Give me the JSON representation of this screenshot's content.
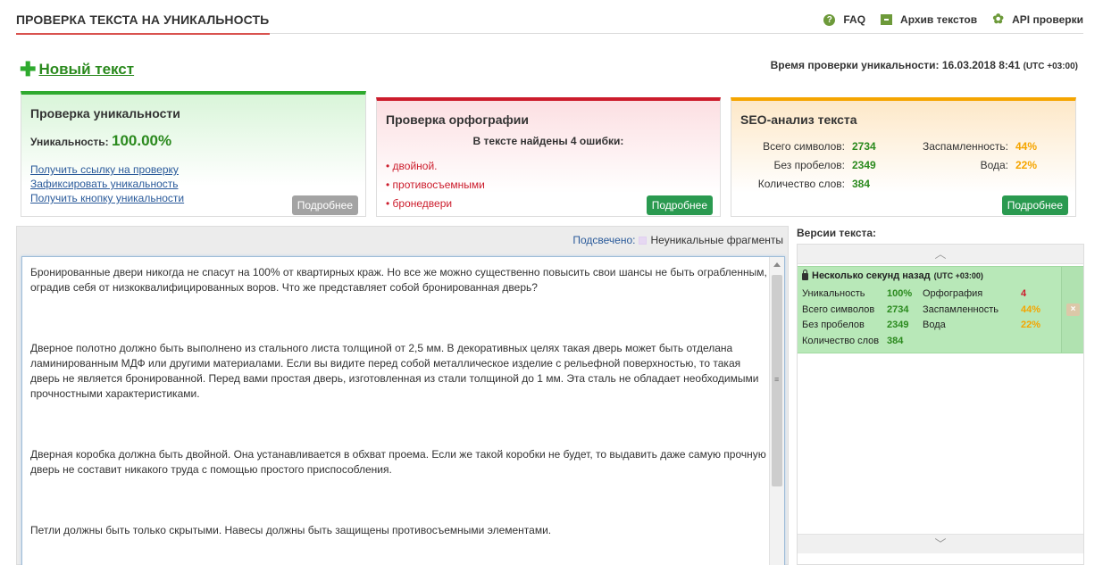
{
  "header": {
    "title": "ПРОВЕРКА ТЕКСТА НА УНИКАЛЬНОСТЬ",
    "nav": [
      {
        "label": "FAQ",
        "icon": "question-icon"
      },
      {
        "label": "Архив текстов",
        "icon": "archive-icon"
      },
      {
        "label": "API проверки",
        "icon": "gear-icon"
      }
    ]
  },
  "new_text": {
    "label": "Новый текст",
    "icon": "plus-icon"
  },
  "check_time": {
    "label": "Время проверки уникальности: 16.03.2018 8:41",
    "tz": "(UTC +03:00)"
  },
  "uniqueness": {
    "title": "Проверка уникальности",
    "label": "Уникальность:",
    "value": "100.00%",
    "links": [
      "Получить ссылку на проверку",
      "Зафиксировать уникальность",
      "Получить кнопку уникальности"
    ],
    "more": "Подробнее"
  },
  "spelling": {
    "title": "Проверка орфографии",
    "count_text": "В тексте найдены 4 ошибки:",
    "errors": [
      "двойной.",
      "противосъемными",
      "бронедвери"
    ],
    "more": "Подробнее"
  },
  "seo": {
    "title": "SEO-анализ текста",
    "left": [
      {
        "label": "Всего символов:",
        "value": "2734"
      },
      {
        "label": "Без пробелов:",
        "value": "2349"
      },
      {
        "label": "Количество слов:",
        "value": "384"
      }
    ],
    "right": [
      {
        "label": "Заспамленность:",
        "value": "44%"
      },
      {
        "label": "Вода:",
        "value": "22%"
      }
    ],
    "more": "Подробнее"
  },
  "editor": {
    "highlight_label": "Подсвечено:",
    "highlight_legend": "Неуникальные фрагменты",
    "paragraphs": [
      "Бронированные двери никогда не спасут на 100% от квартирных краж. Но все же можно существенно повысить свои шансы не быть ограбленным, оградив себя от низкоквалифицированных воров. Что же представляет собой бронированная дверь?",
      "Дверное полотно должно быть выполнено из стального листа толщиной от 2,5 мм. В декоративных целях такая дверь может быть отделана ламинированным МДФ или другими материалами. Если вы видите перед собой металлическое изделие с рельефной поверхностью, то такая дверь не является бронированной. Перед вами простая дверь, изготовленная из стали толщиной до 1 мм. Эта сталь не обладает необходимыми прочностными характеристиками.",
      "Дверная коробка должна быть двойной. Она устанавливается в обхват проема. Если же такой коробки не будет, то выдавить даже самую прочную дверь не составит никакого труда с помощью простого приспособления.",
      "Петли должны быть только скрытыми. Навесы должны быть защищены противосъемными элементами."
    ]
  },
  "versions": {
    "title": "Версии текста:",
    "items": [
      {
        "time": "Несколько секунд назад",
        "tz": "(UTC +03:00)",
        "stats_left": [
          {
            "label": "Уникальность",
            "value": "100%"
          },
          {
            "label": "Всего символов",
            "value": "2734"
          },
          {
            "label": "Без пробелов",
            "value": "2349"
          },
          {
            "label": "Количество слов",
            "value": "384"
          }
        ],
        "stats_right": [
          {
            "label": "Орфография",
            "value": "4"
          },
          {
            "label": "Заспамленность",
            "value": "44%"
          },
          {
            "label": "Вода",
            "value": "22%"
          }
        ],
        "delete_label": "×"
      }
    ]
  }
}
